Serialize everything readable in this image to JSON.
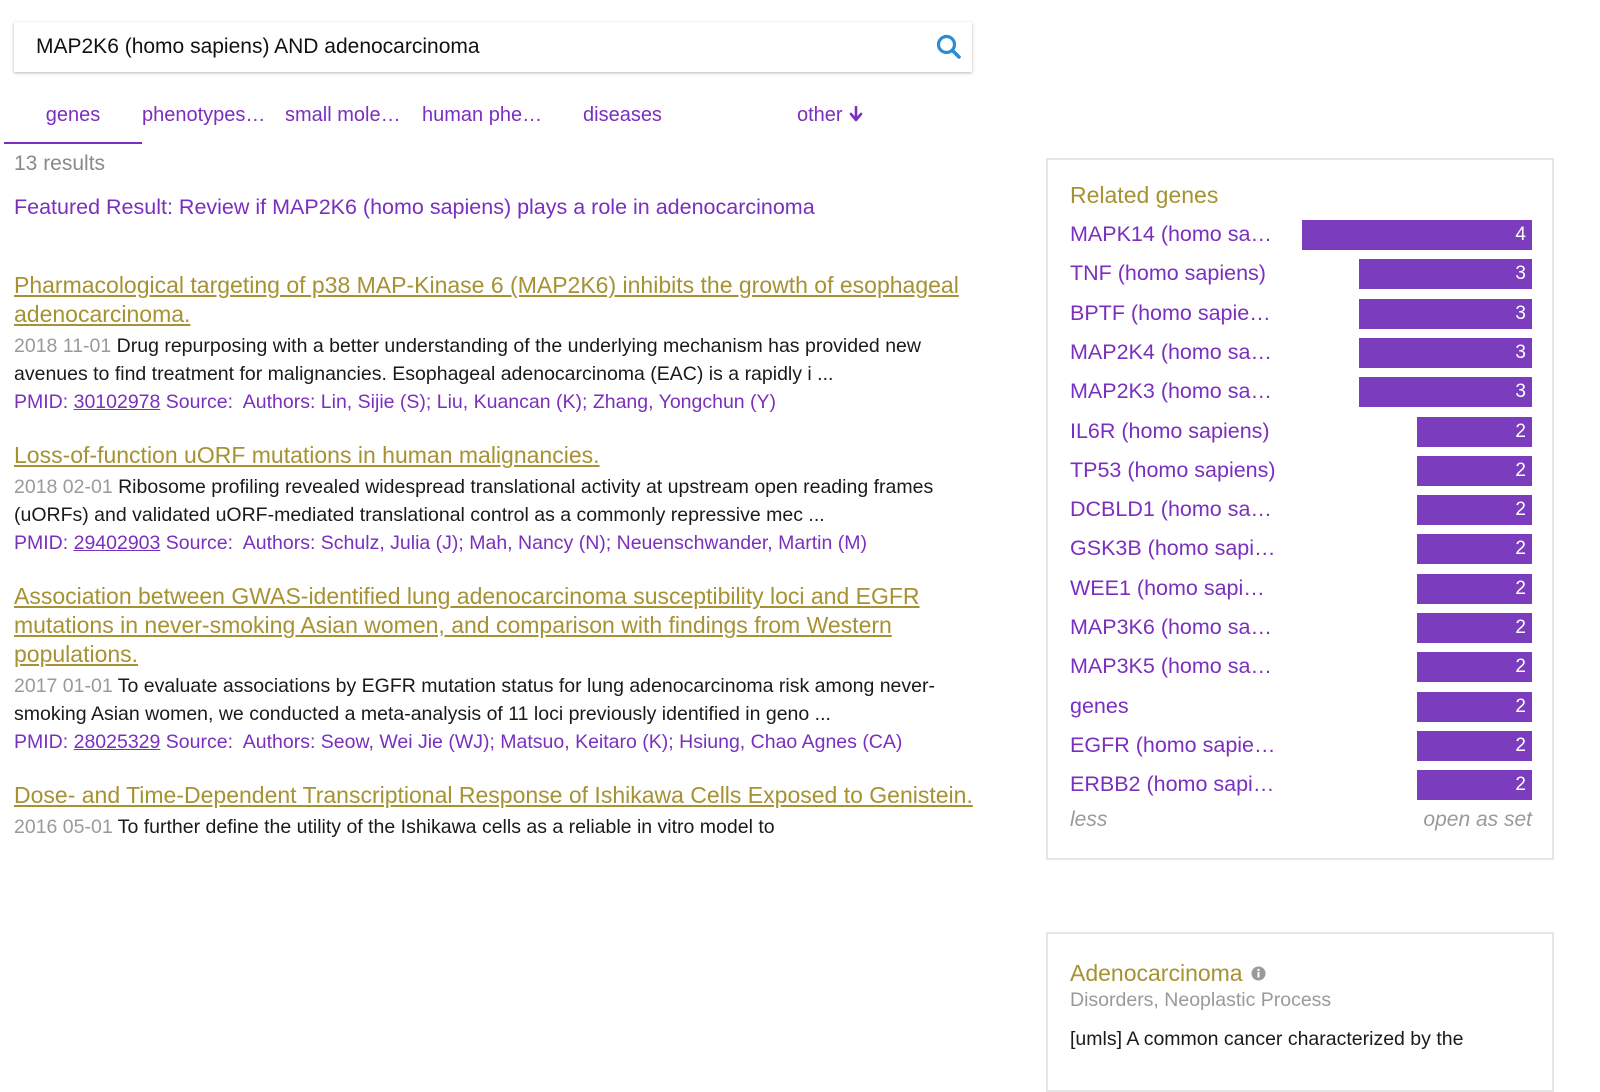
{
  "search": {
    "query": "MAP2K6 (homo sapiens) AND adenocarcinoma"
  },
  "tabs": [
    {
      "label": "genes"
    },
    {
      "label": "phenotypes…"
    },
    {
      "label": "small mole…"
    },
    {
      "label": "human phe…"
    },
    {
      "label": "diseases"
    },
    {
      "label": "other"
    }
  ],
  "results_count": "13 results",
  "featured": "Featured Result: Review if MAP2K6 (homo sapiens) plays a role in adenocarcinoma",
  "results": [
    {
      "title": "Pharmacological targeting of p38 MAP-Kinase 6 (MAP2K6) inhibits the growth of esophageal adenocarcinoma.",
      "date": "2018 11-01",
      "abstract": "Drug repurposing with a better understanding of the underlying mechanism has provided new avenues to find treatment for malignancies. Esophageal adenocarcinoma (EAC) is a rapidly i ...",
      "pmid_label": "PMID:",
      "pmid": "30102978",
      "source": "Source:",
      "authors": "Authors: Lin, Sijie (S); Liu, Kuancan (K); Zhang, Yongchun (Y)"
    },
    {
      "title": "Loss-of-function uORF mutations in human malignancies.",
      "date": "2018 02-01",
      "abstract": "Ribosome profiling revealed widespread translational activity at upstream open reading frames (uORFs) and validated uORF-mediated translational control as a commonly repressive mec ...",
      "pmid_label": "PMID:",
      "pmid": "29402903",
      "source": "Source:",
      "authors": "Authors: Schulz, Julia (J); Mah, Nancy (N); Neuenschwander, Martin (M)"
    },
    {
      "title": "Association between GWAS-identified lung adenocarcinoma susceptibility loci and EGFR mutations in never-smoking Asian women, and comparison with findings from Western populations.",
      "date": "2017 01-01",
      "abstract": "To evaluate associations by EGFR mutation status for lung adenocarcinoma risk among never-smoking Asian women, we conducted a meta-analysis of 11 loci previously identified in geno ...",
      "pmid_label": "PMID:",
      "pmid": "28025329",
      "source": "Source:",
      "authors": "Authors: Seow, Wei Jie (WJ); Matsuo, Keitaro (K); Hsiung, Chao Agnes (CA)"
    },
    {
      "title": "Dose- and Time-Dependent Transcriptional Response of Ishikawa Cells Exposed to Genistein.",
      "date": "2016 05-01",
      "abstract": "To further define the utility of the Ishikawa cells as a reliable in vitro model to",
      "pmid_label": "",
      "pmid": "",
      "source": "",
      "authors": ""
    }
  ],
  "related_genes": {
    "title": "Related genes",
    "max": 4,
    "items": [
      {
        "name": "MAPK14 (homo sa…",
        "count": 4
      },
      {
        "name": "TNF (homo sapiens)",
        "count": 3
      },
      {
        "name": "BPTF (homo sapie…",
        "count": 3
      },
      {
        "name": "MAP2K4 (homo sa…",
        "count": 3
      },
      {
        "name": "MAP2K3 (homo sa…",
        "count": 3
      },
      {
        "name": "IL6R (homo sapiens)",
        "count": 2
      },
      {
        "name": "TP53 (homo sapiens)",
        "count": 2
      },
      {
        "name": "DCBLD1 (homo sa…",
        "count": 2
      },
      {
        "name": "GSK3B (homo sapi…",
        "count": 2
      },
      {
        "name": "WEE1 (homo sapi…",
        "count": 2
      },
      {
        "name": "MAP3K6 (homo sa…",
        "count": 2
      },
      {
        "name": "MAP3K5 (homo sa…",
        "count": 2
      },
      {
        "name": "genes",
        "count": 2
      },
      {
        "name": "EGFR (homo sapie…",
        "count": 2
      },
      {
        "name": "ERBB2 (homo sapi…",
        "count": 2
      }
    ],
    "less_label": "less",
    "open_label": "open as set"
  },
  "disease": {
    "title": "Adenocarcinoma",
    "subtitle": "Disorders, Neoplastic Process",
    "description": "[umls] A common cancer characterized by the"
  },
  "colors": {
    "accent_purple": "#7b2fbe",
    "bar_purple": "#7b3dbd",
    "title_olive": "#a69233",
    "search_blue": "#2b8cd6"
  }
}
